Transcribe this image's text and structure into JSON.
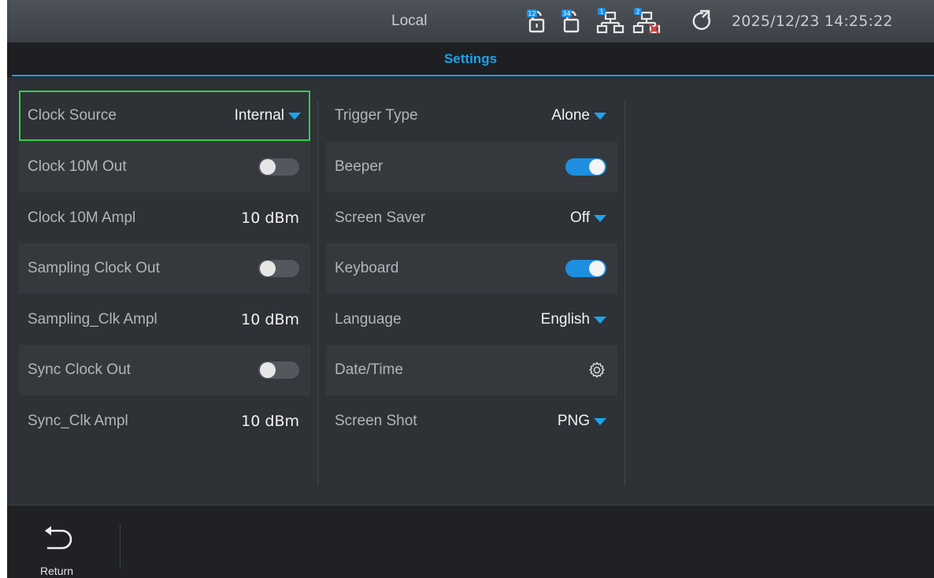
{
  "status": {
    "mode": "Local",
    "datetime": "2025/12/23 14:25:22",
    "icons": [
      {
        "name": "lock-12-icon",
        "badge": "12"
      },
      {
        "name": "lock-34-icon",
        "badge": "34"
      },
      {
        "name": "network-1-icon",
        "badge": "1"
      },
      {
        "name": "network-2-disconnected-icon",
        "badge": "2"
      },
      {
        "name": "refresh-icon"
      }
    ]
  },
  "title": "Settings",
  "left_column": {
    "clock_source": {
      "label": "Clock Source",
      "value": "Internal"
    },
    "clock_10m_out": {
      "label": "Clock 10M Out",
      "state": "off"
    },
    "clock_10m_ampl": {
      "label": "Clock 10M Ampl",
      "value": "10 dBm"
    },
    "sampling_clock_out": {
      "label": "Sampling Clock Out",
      "state": "off"
    },
    "sampling_clk_ampl": {
      "label": "Sampling_Clk Ampl",
      "value": "10 dBm"
    },
    "sync_clock_out": {
      "label": "Sync Clock Out",
      "state": "off"
    },
    "sync_clk_ampl": {
      "label": "Sync_Clk Ampl",
      "value": "10 dBm"
    }
  },
  "right_column": {
    "trigger_type": {
      "label": "Trigger Type",
      "value": "Alone"
    },
    "beeper": {
      "label": "Beeper",
      "state": "on"
    },
    "screen_saver": {
      "label": "Screen Saver",
      "value": "Off"
    },
    "keyboard": {
      "label": "Keyboard",
      "state": "on"
    },
    "language": {
      "label": "Language",
      "value": "English"
    },
    "date_time": {
      "label": "Date/Time",
      "icon": "gear-icon"
    },
    "screen_shot": {
      "label": "Screen Shot",
      "value": "PNG"
    }
  },
  "bottom": {
    "return_label": "Return"
  },
  "colors": {
    "accent": "#1ea3ea",
    "selection": "#2fd14c",
    "toggle_on": "#1e8ee0",
    "alert": "#e0443a"
  }
}
